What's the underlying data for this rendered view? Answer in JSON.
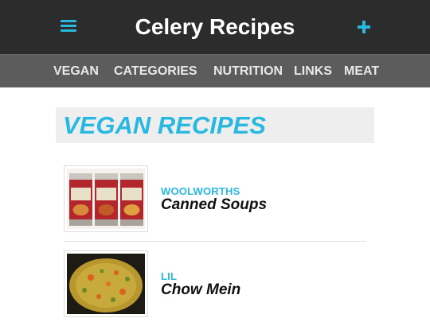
{
  "header": {
    "title": "Celery Recipes",
    "menu_icon": "hamburger-menu-icon",
    "add_icon": "plus-icon",
    "accent_color": "#29b8e0"
  },
  "nav": {
    "items": [
      {
        "label": "VEGAN"
      },
      {
        "label": "CATEGORIES"
      },
      {
        "label": "NUTRITION"
      },
      {
        "label": "LINKS"
      },
      {
        "label": "MEAT"
      }
    ]
  },
  "main": {
    "section_title": "VEGAN RECIPES",
    "recipes": [
      {
        "source": "WOOLWORTHS",
        "name": "Canned Soups"
      },
      {
        "source": "LIL",
        "name": "Chow Mein"
      }
    ]
  }
}
